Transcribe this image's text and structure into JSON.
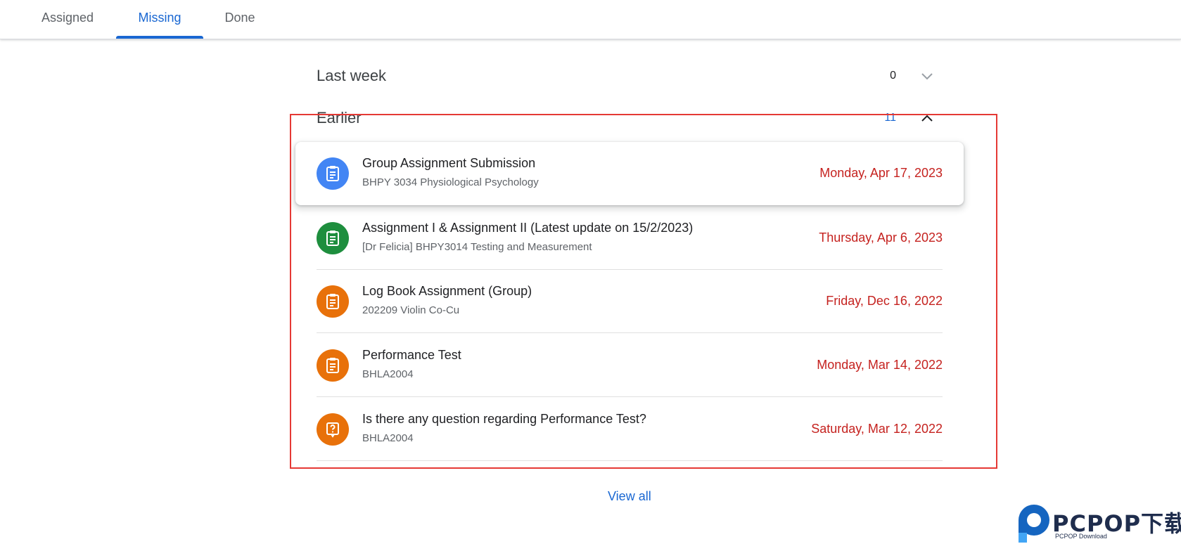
{
  "tabs": [
    {
      "label": "Assigned",
      "active": false
    },
    {
      "label": "Missing",
      "active": true
    },
    {
      "label": "Done",
      "active": false
    }
  ],
  "sections": {
    "last_week": {
      "title": "Last week",
      "count": "0",
      "expanded": false
    },
    "earlier": {
      "title": "Earlier",
      "count": "11",
      "expanded": true
    }
  },
  "items": [
    {
      "title": "Group Assignment Submission",
      "course": "BHPY 3034 Physiological Psychology",
      "due": "Monday, Apr 17, 2023",
      "icon": "assignment-icon",
      "color": "#4285f4"
    },
    {
      "title": "Assignment I & Assignment II (Latest update on 15/2/2023)",
      "course": "[Dr Felicia] BHPY3014 Testing and Measurement",
      "due": "Thursday, Apr 6, 2023",
      "icon": "assignment-icon",
      "color": "#1e8e3e"
    },
    {
      "title": "Log Book Assignment (Group)",
      "course": "202209 Violin Co-Cu",
      "due": "Friday, Dec 16, 2022",
      "icon": "assignment-icon",
      "color": "#e8710a"
    },
    {
      "title": "Performance Test",
      "course": "BHLA2004",
      "due": "Monday, Mar 14, 2022",
      "icon": "assignment-icon",
      "color": "#e8710a"
    },
    {
      "title": "Is there any question regarding Performance Test?",
      "course": "BHLA2004",
      "due": "Saturday, Mar 12, 2022",
      "icon": "question-icon",
      "color": "#e8710a"
    }
  ],
  "view_all": "View all",
  "watermark": {
    "brand": "PCPOP下载",
    "sub": "PCPOP Download"
  },
  "colors": {
    "accent": "#1967d2",
    "due_red": "#c5221f"
  }
}
